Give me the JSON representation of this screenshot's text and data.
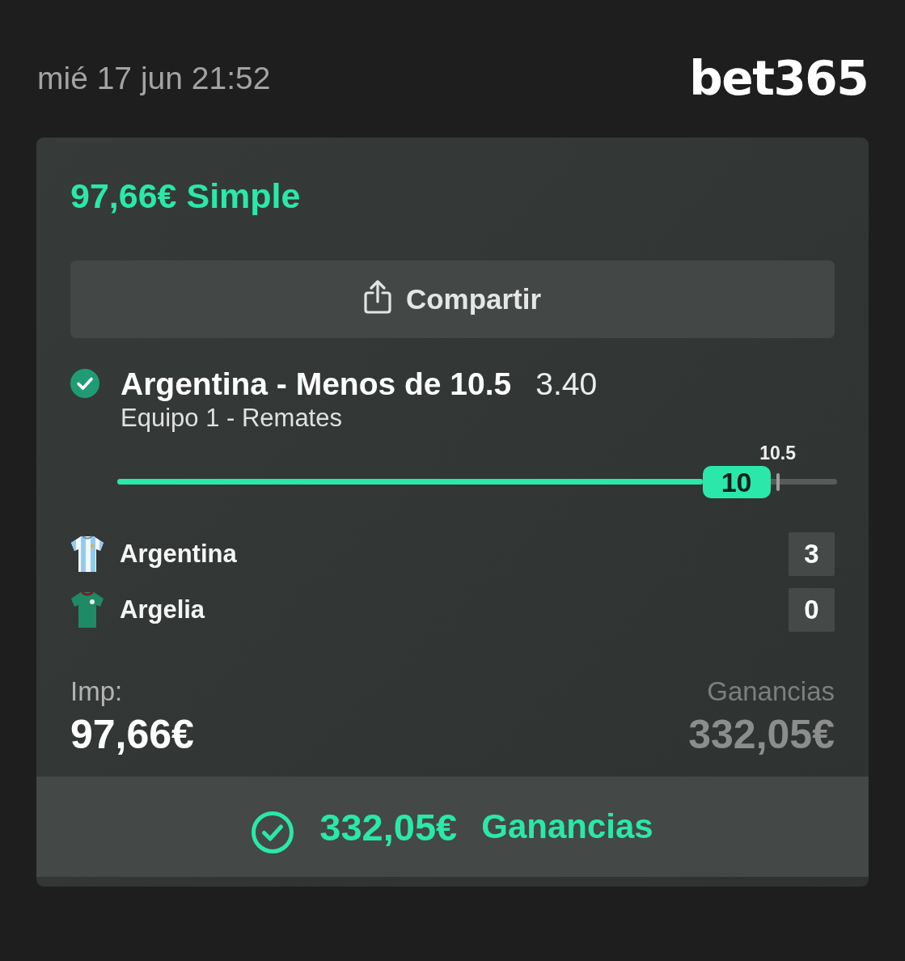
{
  "header": {
    "datetime": "mié 17 jun 21:52",
    "logo": "bet365"
  },
  "bet": {
    "title": "97,66€ Simple",
    "share_button": "Compartir",
    "selection": {
      "won": true,
      "pick": "Argentina - Menos de 10.5",
      "odds": "3.40",
      "market": "Equipo 1 - Remates"
    },
    "slider": {
      "level": 0.813,
      "thumb_label": "10",
      "line_label": "10.5"
    },
    "teams": [
      {
        "name": "Argentina",
        "score": "3",
        "kind": "striped",
        "color": "#8fcdf0"
      },
      {
        "name": "Argelia",
        "score": "0",
        "kind": "plain",
        "color": "#1f8a66"
      }
    ],
    "stake": {
      "label": "Imp:",
      "value": "97,66€"
    },
    "returns": {
      "label": "Ganancias",
      "value": "332,05€"
    },
    "result_bar": {
      "won": true,
      "amount": "332,05€",
      "label": "Ganancias"
    }
  }
}
